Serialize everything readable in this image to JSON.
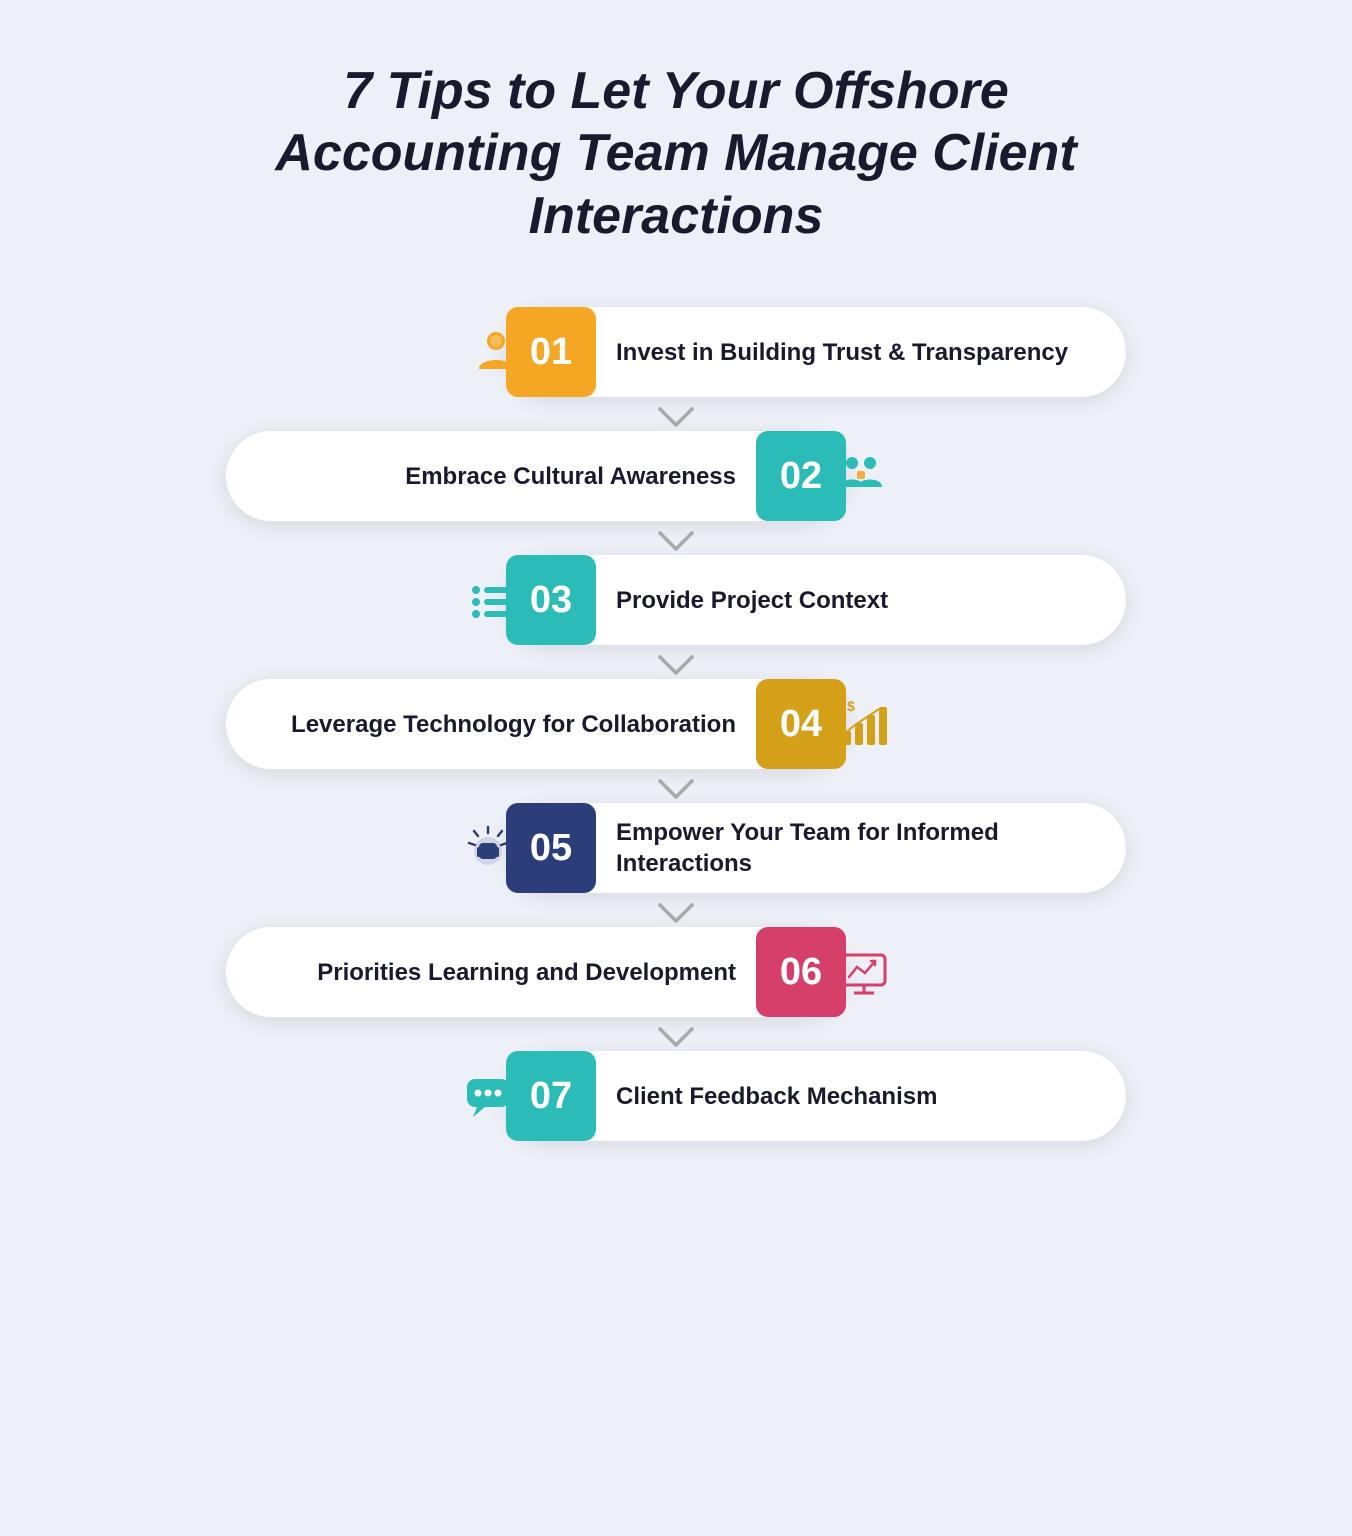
{
  "title": {
    "line1": "7 Tips to Let Your Offshore Accounting",
    "line2": "Team Manage Client Interactions",
    "full": "7 Tips to Let Your Offshore Accounting Team Manage Client Interactions"
  },
  "tips": [
    {
      "number": "01",
      "text": "Invest in Building Trust & Transparency",
      "icon_name": "person-icon",
      "icon_color": "#F5A623",
      "num_color": "#F5A623",
      "side": "odd"
    },
    {
      "number": "02",
      "text": "Embrace Cultural Awareness",
      "icon_name": "puzzle-people-icon",
      "icon_color": "#2BBCB8",
      "num_color": "#2BBCB8",
      "side": "even"
    },
    {
      "number": "03",
      "text": "Provide Project Context",
      "icon_name": "list-icon",
      "icon_color": "#2BBCB8",
      "num_color": "#2BBCB8",
      "side": "odd"
    },
    {
      "number": "04",
      "text": "Leverage Technology for Collaboration",
      "icon_name": "chart-money-icon",
      "icon_color": "#D4A017",
      "num_color": "#D4A017",
      "side": "even"
    },
    {
      "number": "05",
      "text": "Empower Your Team for Informed Interactions",
      "icon_name": "fist-icon",
      "icon_color": "#2C3E7A",
      "num_color": "#2C3E7A",
      "side": "odd"
    },
    {
      "number": "06",
      "text": "Priorities Learning and Development",
      "icon_name": "screen-chart-icon",
      "icon_color": "#D63F6A",
      "num_color": "#D63F6A",
      "side": "even"
    },
    {
      "number": "07",
      "text": "Client Feedback Mechanism",
      "icon_name": "chat-icon",
      "icon_color": "#2BBCB8",
      "num_color": "#2BBCB8",
      "side": "odd"
    }
  ],
  "colors": {
    "bg": "#eef0f8",
    "card": "#ffffff",
    "title": "#1a1a2e"
  }
}
